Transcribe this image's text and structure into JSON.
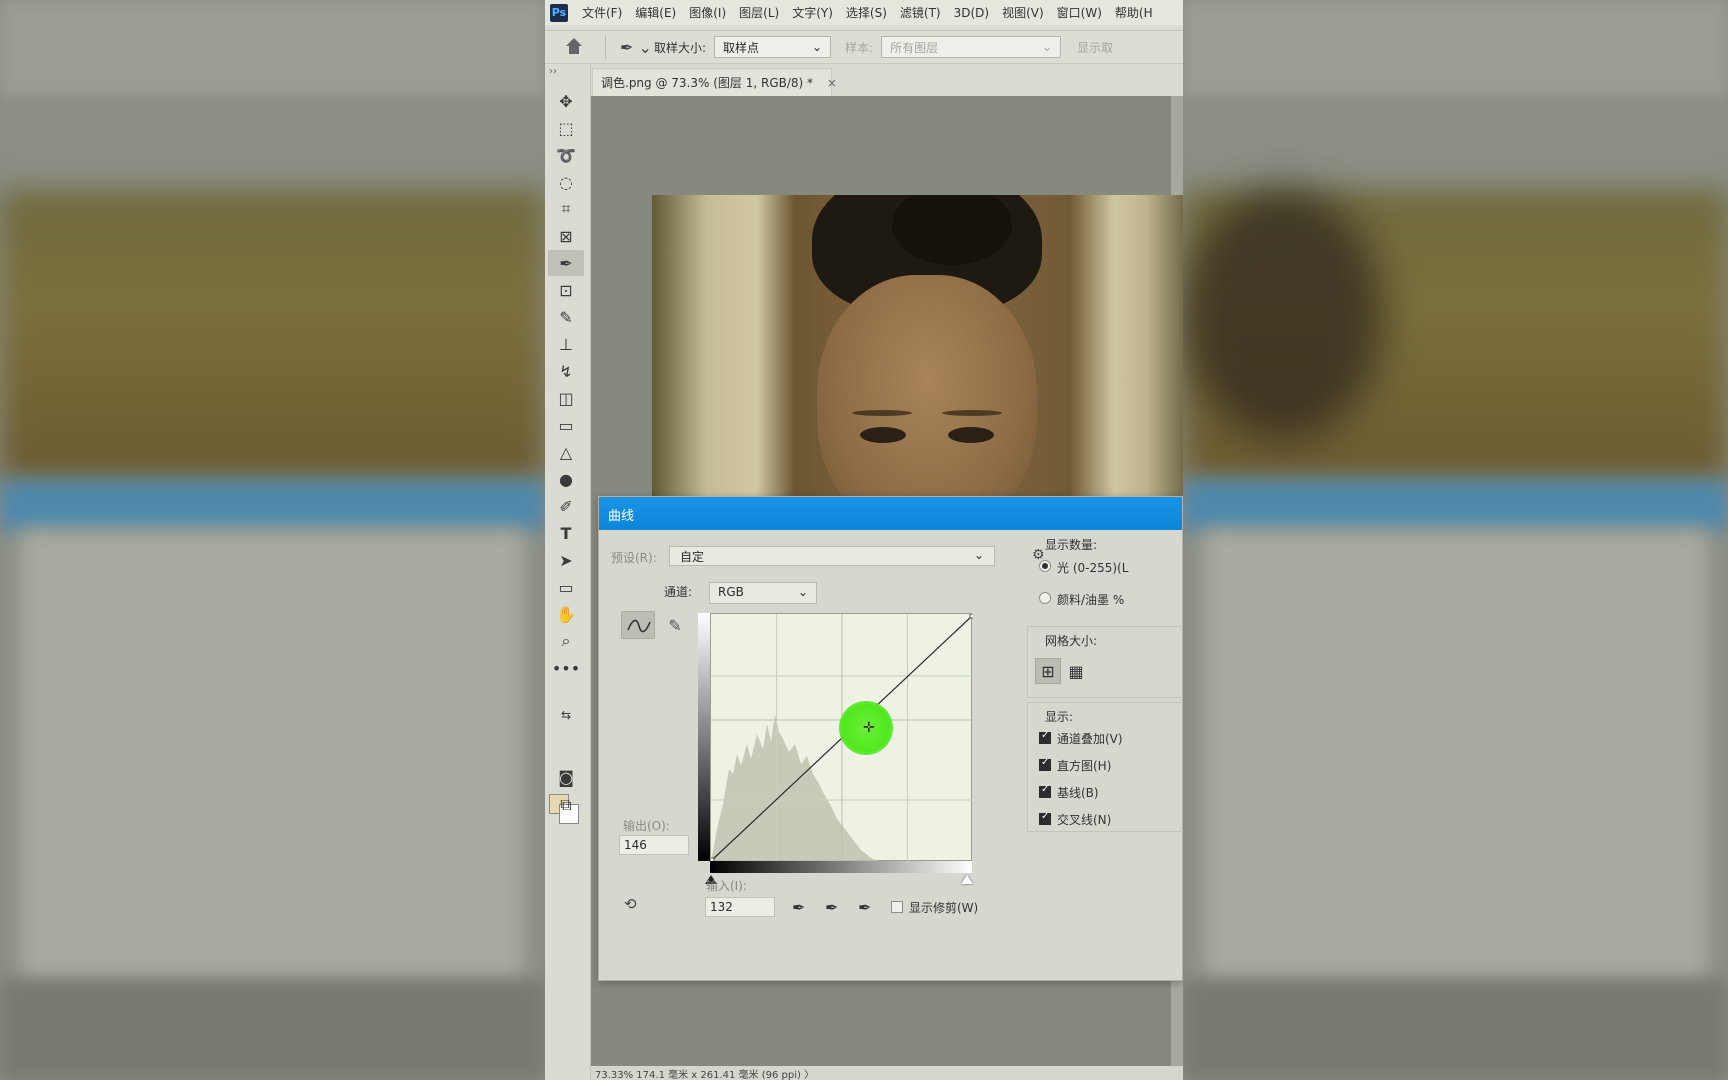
{
  "menubar": {
    "logo": "Ps",
    "items": [
      "文件(F)",
      "编辑(E)",
      "图像(I)",
      "图层(L)",
      "文字(Y)",
      "选择(S)",
      "滤镜(T)",
      "3D(D)",
      "视图(V)",
      "窗口(W)",
      "帮助(H"
    ]
  },
  "options": {
    "sample_size_label": "取样大小:",
    "sample_size_value": "取样点",
    "sample_label": "样本:",
    "sample_value": "所有图层",
    "show_ring": "显示取"
  },
  "tab": {
    "title": "调色.png @ 73.3% (图层 1, RGB/8) *",
    "close": "×"
  },
  "status": {
    "text": "73.33%   174.1 毫米 x 261.41 毫米 (96 ppi)  〉"
  },
  "dialog": {
    "title": "曲线",
    "preset_label": "预设(R):",
    "preset_value": "自定",
    "channel_label": "通道:",
    "channel_value": "RGB",
    "output_label": "输出(O):",
    "output_value": "146",
    "input_label": "输入(I):",
    "input_value": "132",
    "show_clipping_label": "显示修剪(W)",
    "show_amount_label": "显示数量:",
    "light_label": "光 (0-255)(L",
    "pigment_label": "颜料/油墨 %",
    "grid_size_label": "网格大小:",
    "display_label": "显示:",
    "channel_overlay_label": "通道叠加(V)",
    "histogram_label": "直方图(H)",
    "baseline_label": "基线(B)",
    "intersection_label": "交叉线(N)"
  },
  "colors": {
    "title_bar": "#0c86d8",
    "cursor_highlight": "#4fe81e",
    "foreground_swatch": "#e8d8b0",
    "background_swatch": "#ffffff"
  },
  "icons": {
    "tools": [
      "move-icon",
      "marquee-icon",
      "lasso-icon",
      "quick-select-icon",
      "crop-icon",
      "frame-icon",
      "eyedropper-icon",
      "patch-icon",
      "brush-icon",
      "stamp-icon",
      "history-brush-icon",
      "eraser-icon",
      "gradient-icon",
      "blur-icon",
      "dodge-icon",
      "pen-icon",
      "type-icon",
      "path-select-icon",
      "rectangle-icon",
      "hand-icon",
      "zoom-icon",
      "more-icon"
    ]
  }
}
